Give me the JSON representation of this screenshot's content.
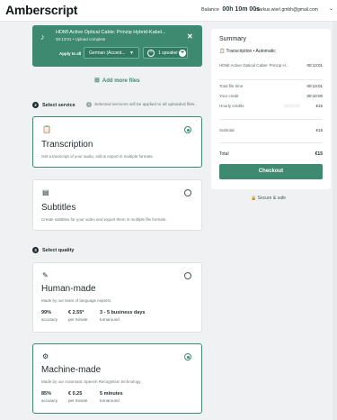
{
  "header": {
    "logo": "Amberscript",
    "balance_label": "Balance",
    "balance_value": "00h 10m 00s",
    "user_email": "markus.wierl.gmbh@gmail.com",
    "user_caret": "⌄"
  },
  "upload": {
    "file_name": "HDMI Active Optical Cable: Prinzip Hybrid-Kabel...",
    "meta": "00:13:01  •  Upload complete",
    "apply_all": "Apply to all",
    "language": "German (Accent...",
    "speakers": "1 speaker",
    "close": "✕"
  },
  "add_more": "Add more files",
  "step_service": {
    "num": "2",
    "label": "Select service"
  },
  "service_hint": "Selected services will be applied to all uploaded files.",
  "services": [
    {
      "title": "Transcription",
      "desc": "Get a transcript of your audio, edit & export in multiple formats.",
      "selected": true
    },
    {
      "title": "Subtitles",
      "desc": "Create subtitles for your video and export them in multiple file formats.",
      "selected": false
    }
  ],
  "step_quality": {
    "num": "3",
    "label": "Select quality"
  },
  "qualities": [
    {
      "title": "Human-made",
      "desc": "Made by our team of language experts.",
      "accuracy": "99%",
      "accuracy_label": "accuracy",
      "price": "€ 2.55*",
      "price_label": "per minute",
      "turnaround": "3 - 5 business days",
      "turnaround_label": "turnaround",
      "selected": false
    },
    {
      "title": "Machine-made",
      "desc": "Made by our Automatic Speech Recognition technology",
      "accuracy": "85%",
      "accuracy_label": "accuracy",
      "price": "€ 0.25",
      "price_label": "per minute",
      "turnaround": "5 minutes",
      "turnaround_label": "turnaround",
      "selected": true
    }
  ],
  "summary": {
    "title": "Summary",
    "service": "Transcription • Automatic",
    "file_line": "HDMI Active Optical Cable: Prinzip H...",
    "file_time": "00:13:01",
    "total_file_time_label": "Total file time",
    "total_file_time": "00:13:01",
    "your_credit_label": "Your credit",
    "your_credit": "00:10:00",
    "hourly_credits_label": "Hourly credits",
    "hourly_credits_mid": "00:00:00",
    "hourly_credits": "€15",
    "subtotal_label": "Subtotal",
    "subtotal": "€15",
    "total_label": "Total",
    "total": "€15",
    "checkout": "Checkout",
    "secure": "Secure & safe"
  },
  "colors": {
    "accent": "#3e8a70",
    "background": "#f0f1f2"
  }
}
